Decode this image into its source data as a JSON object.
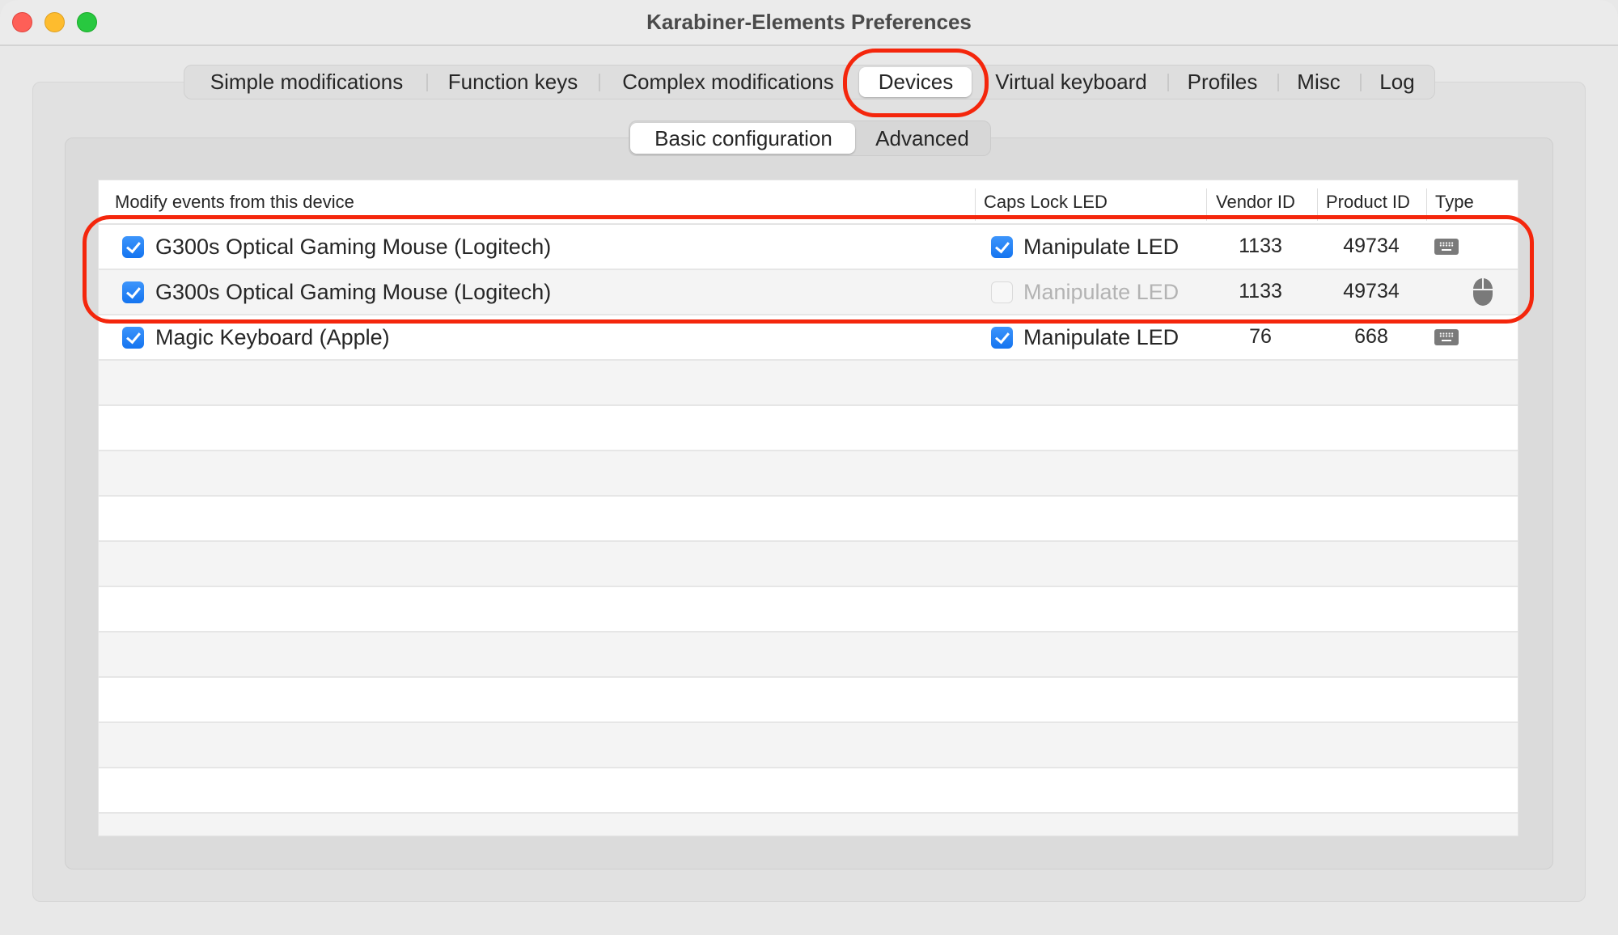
{
  "window": {
    "title": "Karabiner-Elements Preferences",
    "traffic_lights": [
      "close",
      "minimize",
      "zoom"
    ]
  },
  "tabs": [
    {
      "label": "Simple modifications",
      "selected": false
    },
    {
      "label": "Function keys",
      "selected": false
    },
    {
      "label": "Complex modifications",
      "selected": false
    },
    {
      "label": "Devices",
      "selected": true
    },
    {
      "label": "Virtual keyboard",
      "selected": false
    },
    {
      "label": "Profiles",
      "selected": false
    },
    {
      "label": "Misc",
      "selected": false
    },
    {
      "label": "Log",
      "selected": false
    }
  ],
  "subtabs": [
    {
      "label": "Basic configuration",
      "selected": true
    },
    {
      "label": "Advanced",
      "selected": false
    }
  ],
  "table": {
    "columns": [
      "Modify events from this device",
      "Caps Lock LED",
      "Vendor ID",
      "Product ID",
      "Type"
    ],
    "rows": [
      {
        "modify": true,
        "name": "G300s Optical Gaming Mouse (Logitech)",
        "caps_lock_led": true,
        "caps_lock_led_enabled": true,
        "caps_lock_label": "Manipulate LED",
        "vendor_id": "1133",
        "product_id": "49734",
        "type": "keyboard-icon"
      },
      {
        "modify": true,
        "name": "G300s Optical Gaming Mouse (Logitech)",
        "caps_lock_led": false,
        "caps_lock_led_enabled": false,
        "caps_lock_label": "Manipulate LED",
        "vendor_id": "1133",
        "product_id": "49734",
        "type": "mouse-icon"
      },
      {
        "modify": true,
        "name": "Magic Keyboard (Apple)",
        "caps_lock_led": true,
        "caps_lock_led_enabled": true,
        "caps_lock_label": "Manipulate LED",
        "vendor_id": "76",
        "product_id": "668",
        "type": "keyboard-icon"
      }
    ]
  },
  "annotations": {
    "highlight_color": "#f4260c",
    "highlighted": [
      "Devices tab",
      "G300s Optical Gaming Mouse rows"
    ]
  },
  "colors": {
    "accent": "#1474f0",
    "disabled_text": "#b3b3b3"
  }
}
